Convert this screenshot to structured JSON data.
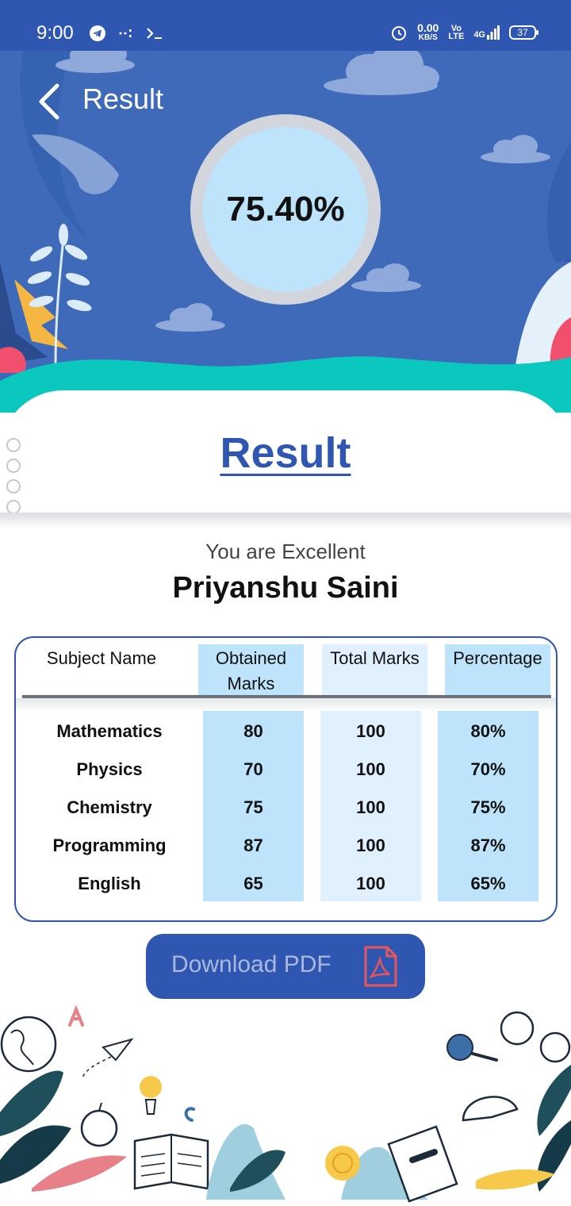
{
  "status_bar": {
    "time": "9:00",
    "net_speed_value": "0.00",
    "net_speed_unit": "KB/S",
    "volte_top": "Vo",
    "volte_bottom": "LTE",
    "network": "4G",
    "battery": "37"
  },
  "header": {
    "title": "Result",
    "score": "75.40%"
  },
  "card": {
    "heading": "Result",
    "remark": "You are Excellent",
    "student_name": "Priyanshu Saini"
  },
  "table": {
    "headers": {
      "subject": "Subject Name",
      "obtained_line1": "Obtained",
      "obtained_line2": "Marks",
      "total": "Total Marks",
      "percentage": "Percentage"
    },
    "rows": [
      {
        "subject": "Mathematics",
        "obtained": "80",
        "total": "100",
        "percentage": "80%"
      },
      {
        "subject": "Physics",
        "obtained": "70",
        "total": "100",
        "percentage": "70%"
      },
      {
        "subject": "Chemistry",
        "obtained": "75",
        "total": "100",
        "percentage": "75%"
      },
      {
        "subject": "Programming",
        "obtained": "87",
        "total": "100",
        "percentage": "87%"
      },
      {
        "subject": "English",
        "obtained": "65",
        "total": "100",
        "percentage": "65%"
      }
    ]
  },
  "download": {
    "label": "Download PDF",
    "icon": "pdf-file-icon"
  },
  "colors": {
    "primary": "#2f57b1",
    "hero_bg": "#3f6ab9",
    "wave": "#0bc8bf",
    "score_fill": "#bde4fb",
    "column_highlight": "#bde4fb",
    "column_light": "#e0f1fd"
  }
}
